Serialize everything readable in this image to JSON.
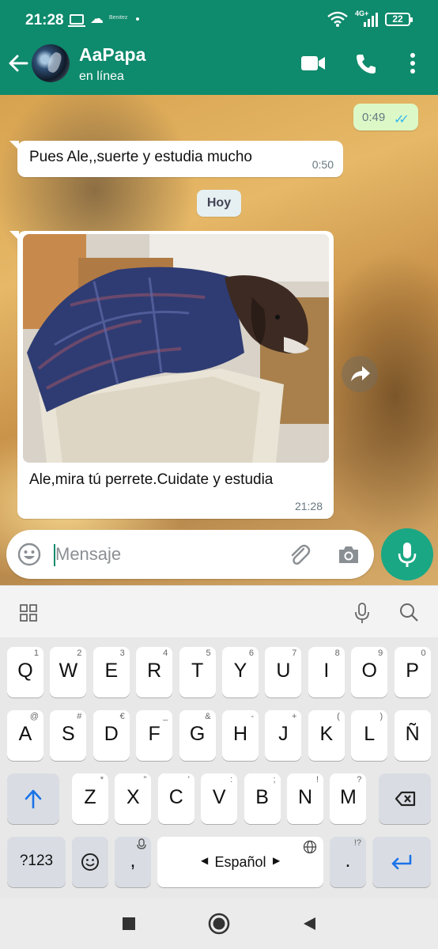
{
  "status_bar": {
    "time": "21:28",
    "small_label": "Benitez",
    "network": "4G+",
    "battery": "22"
  },
  "chat_header": {
    "contact_name": "AaPapa",
    "contact_status": "en línea"
  },
  "messages": [
    {
      "direction": "out",
      "time": "0:49",
      "status": "read"
    },
    {
      "direction": "in",
      "text": "Pues Ale,,suerte y estudia mucho",
      "time": "0:50"
    },
    {
      "type": "date_separator",
      "label": "Hoy"
    },
    {
      "direction": "in",
      "type": "image",
      "caption": "Ale,mira tú perrete.Cuidate y estudia",
      "time": "21:28"
    }
  ],
  "composer": {
    "placeholder": "Mensaje"
  },
  "keyboard": {
    "row1": [
      {
        "k": "Q",
        "h": "1"
      },
      {
        "k": "W",
        "h": "2"
      },
      {
        "k": "E",
        "h": "3"
      },
      {
        "k": "R",
        "h": "4"
      },
      {
        "k": "T",
        "h": "5"
      },
      {
        "k": "Y",
        "h": "6"
      },
      {
        "k": "U",
        "h": "7"
      },
      {
        "k": "I",
        "h": "8"
      },
      {
        "k": "O",
        "h": "9"
      },
      {
        "k": "P",
        "h": "0"
      }
    ],
    "row2": [
      {
        "k": "A",
        "h": "@"
      },
      {
        "k": "S",
        "h": "#"
      },
      {
        "k": "D",
        "h": "€"
      },
      {
        "k": "F",
        "h": "_"
      },
      {
        "k": "G",
        "h": "&"
      },
      {
        "k": "H",
        "h": "-"
      },
      {
        "k": "J",
        "h": "+"
      },
      {
        "k": "K",
        "h": "("
      },
      {
        "k": "L",
        "h": ")"
      },
      {
        "k": "Ñ",
        "h": ""
      }
    ],
    "row3": [
      {
        "k": "Z",
        "h": "*"
      },
      {
        "k": "X",
        "h": "\""
      },
      {
        "k": "C",
        "h": "'"
      },
      {
        "k": "V",
        "h": ":"
      },
      {
        "k": "B",
        "h": ";"
      },
      {
        "k": "N",
        "h": "!"
      },
      {
        "k": "M",
        "h": "?"
      }
    ],
    "symbols_key": "?123",
    "comma_key": ",",
    "space_label": "Español",
    "period_key": ".",
    "period_hint": "!?"
  },
  "colors": {
    "header": "#0e8a6c",
    "accent": "#1aa784",
    "outgoing_bubble": "#dcf8c6",
    "read_ticks": "#34b7f1"
  }
}
